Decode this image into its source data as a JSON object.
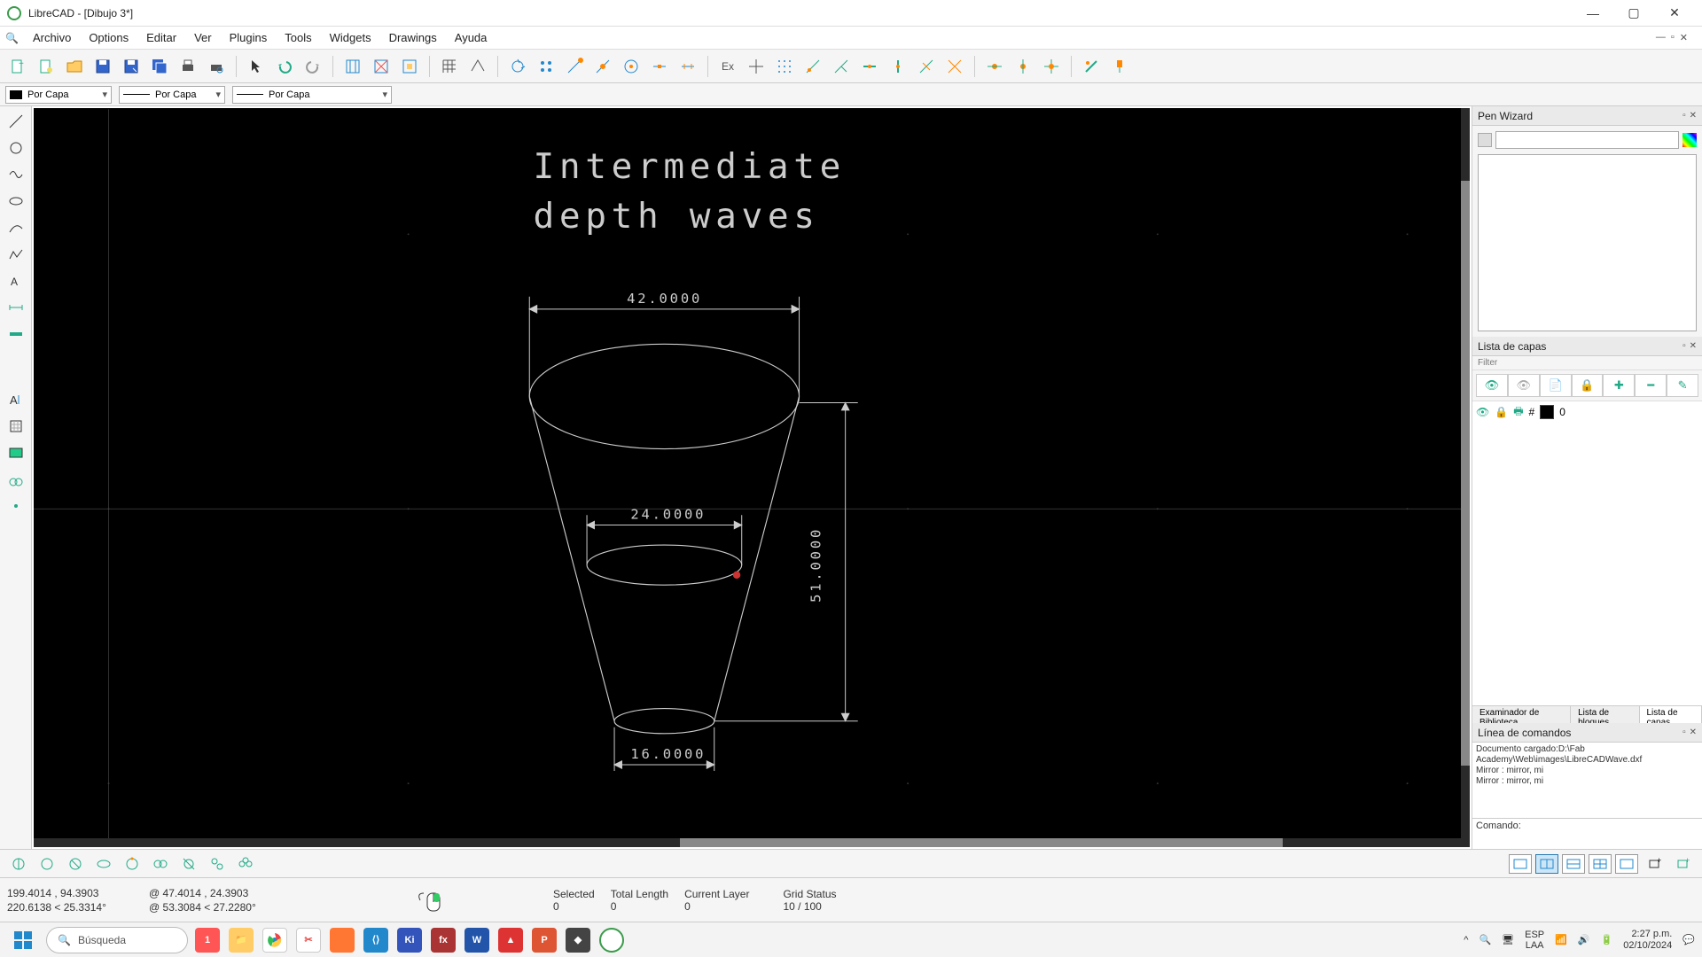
{
  "title": "LibreCAD - [Dibujo 3*]",
  "menu": [
    "Archivo",
    "Options",
    "Editar",
    "Ver",
    "Plugins",
    "Tools",
    "Widgets",
    "Drawings",
    "Ayuda"
  ],
  "penprops": {
    "color": "Por Capa",
    "width": "Por Capa",
    "type": "Por Capa"
  },
  "drawing": {
    "title1": "Intermediate",
    "title2": "depth waves",
    "dim_top": "42.0000",
    "dim_mid": "24.0000",
    "dim_bot": "16.0000",
    "dim_height": "51.0000"
  },
  "penwizard": {
    "title": "Pen Wizard"
  },
  "layers": {
    "title": "Lista de capas",
    "filter": "Filter",
    "layer0": "0",
    "tabs": [
      "Examinador de Biblioteca",
      "Lista de bloques",
      "Lista de capas"
    ]
  },
  "cmd": {
    "title": "Línea de comandos",
    "log": [
      "Documento cargado:D:\\Fab Academy\\Web\\images\\LibreCADWave.dxf",
      "Mirror : mirror, mi",
      "Mirror : mirror, mi"
    ],
    "prompt": "Comando:"
  },
  "status": {
    "abs1": "199.4014 , 94.3903",
    "abs2": "220.6138 < 25.3314°",
    "rel1": "@  47.4014 , 24.3903",
    "rel2": "@  53.3084 < 27.2280°",
    "sel_h": "Selected",
    "sel_v": "0",
    "tot_h": "Total Length",
    "tot_v": "0",
    "lay_h": "Current Layer",
    "lay_v": "0",
    "grid_h": "Grid Status",
    "grid_v": "10 / 100"
  },
  "taskbar": {
    "search": "Búsqueda",
    "lang1": "ESP",
    "lang2": "LAA",
    "time": "2:27 p.m.",
    "date": "02/10/2024"
  }
}
